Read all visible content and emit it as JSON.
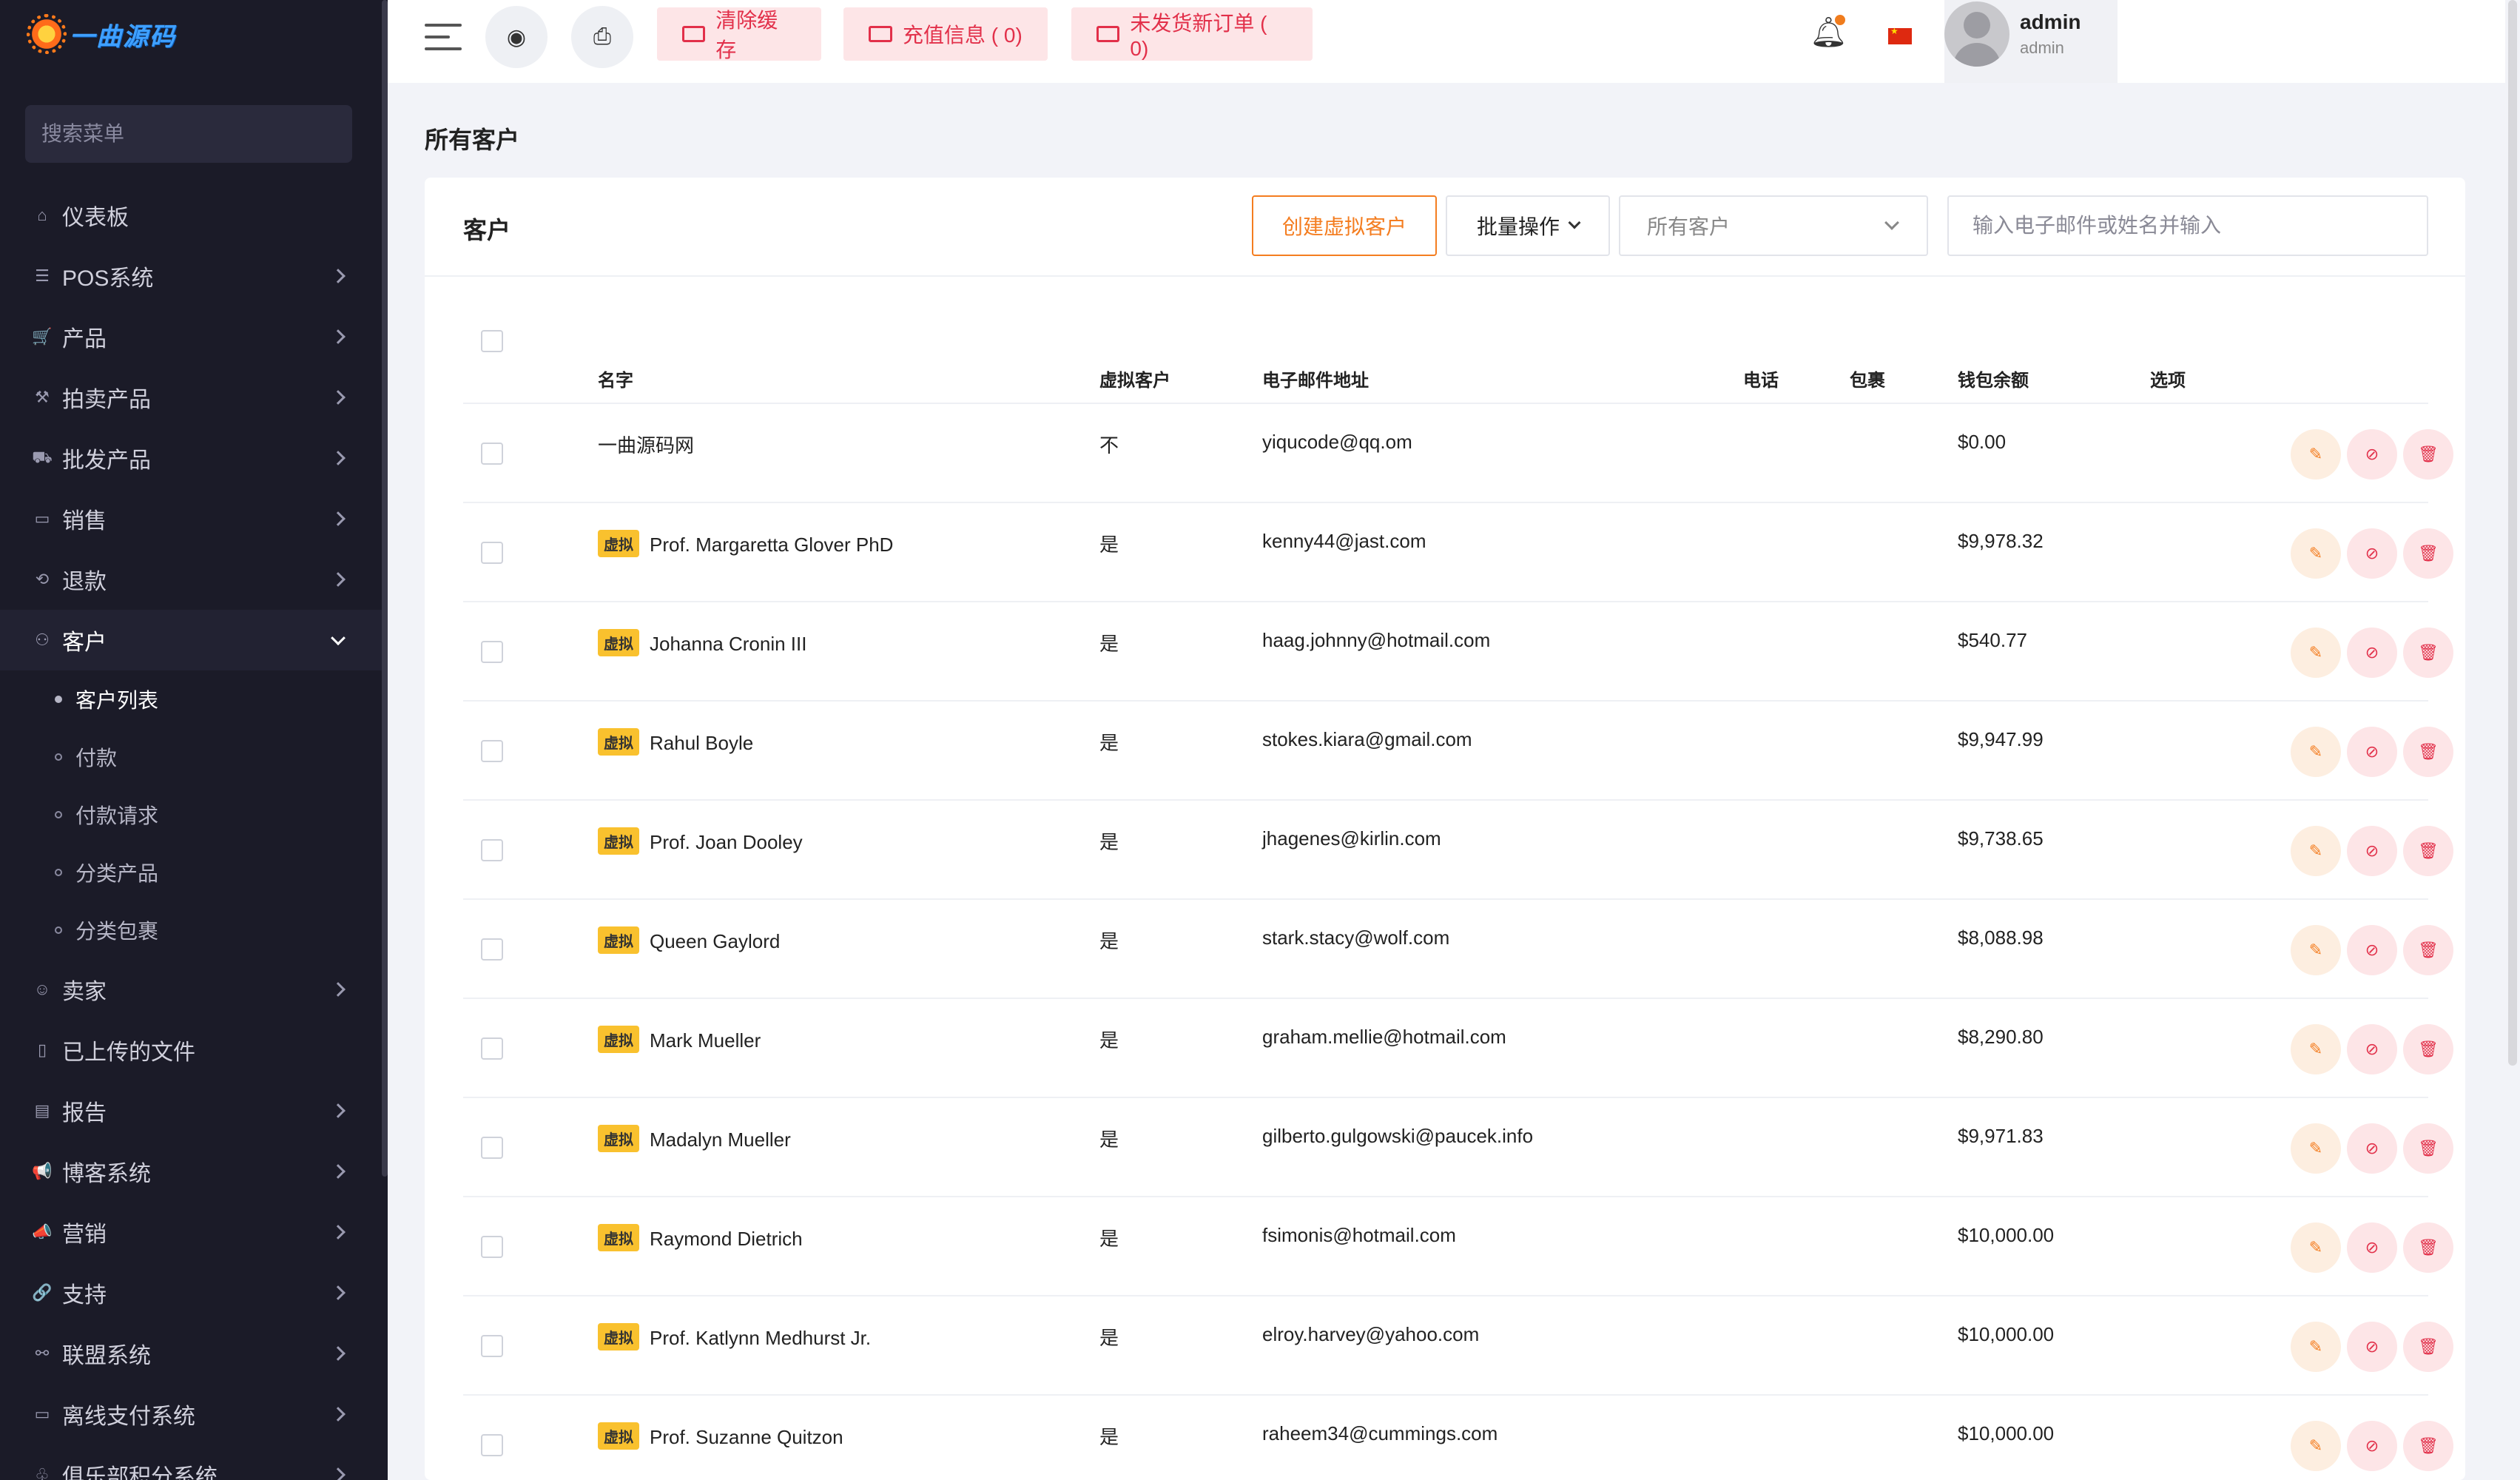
{
  "brand": {
    "logo_text": "一曲源码"
  },
  "sidebar": {
    "search_placeholder": "搜索菜单",
    "items": [
      {
        "label": "仪表板",
        "icon": "home-icon",
        "glyph": "⌂",
        "has_children": false
      },
      {
        "label": "POS系统",
        "icon": "list-icon",
        "glyph": "☰",
        "has_children": true
      },
      {
        "label": "产品",
        "icon": "cart-icon",
        "glyph": "🛒",
        "has_children": true
      },
      {
        "label": "拍卖产品",
        "icon": "gavel-icon",
        "glyph": "⚒",
        "has_children": true
      },
      {
        "label": "批发产品",
        "icon": "truck-icon",
        "glyph": "⛟",
        "has_children": true
      },
      {
        "label": "销售",
        "icon": "money-icon",
        "glyph": "▭",
        "has_children": true
      },
      {
        "label": "退款",
        "icon": "refund-icon",
        "glyph": "⟲",
        "has_children": true
      },
      {
        "label": "客户",
        "icon": "users-icon",
        "glyph": "⚇",
        "has_children": true,
        "open": true
      }
    ],
    "customer_sub": [
      {
        "label": "客户列表",
        "active": true
      },
      {
        "label": "付款",
        "active": false
      },
      {
        "label": "付款请求",
        "active": false
      },
      {
        "label": "分类产品",
        "active": false
      },
      {
        "label": "分类包裹",
        "active": false
      }
    ],
    "items_after": [
      {
        "label": "卖家",
        "icon": "user-icon",
        "glyph": "☺",
        "has_children": true
      },
      {
        "label": "已上传的文件",
        "icon": "file-icon",
        "glyph": "▯",
        "has_children": false
      },
      {
        "label": "报告",
        "icon": "report-icon",
        "glyph": "▤",
        "has_children": true
      },
      {
        "label": "博客系统",
        "icon": "megaphone-icon",
        "glyph": "📢",
        "has_children": true
      },
      {
        "label": "营销",
        "icon": "bullhorn-icon",
        "glyph": "📣",
        "has_children": true
      },
      {
        "label": "支持",
        "icon": "link-icon",
        "glyph": "🔗",
        "has_children": true
      },
      {
        "label": "联盟系统",
        "icon": "affiliate-icon",
        "glyph": "⚯",
        "has_children": true
      },
      {
        "label": "离线支付系统",
        "icon": "card-icon",
        "glyph": "▭",
        "has_children": true
      },
      {
        "label": "俱乐部积分系统",
        "icon": "club-icon",
        "glyph": "♧",
        "has_children": true
      }
    ]
  },
  "topbar": {
    "clear_cache": "清除缓存",
    "recharge": "充值信息 ( 0)",
    "unshipped": "未发货新订单 ( 0)",
    "user_name": "admin",
    "user_role": "admin"
  },
  "page": {
    "title": "所有客户",
    "card_title": "客户",
    "create_button": "创建虚拟客户",
    "bulk_button": "批量操作",
    "filter_selected": "所有客户",
    "search_placeholder": "输入电子邮件或姓名并输入"
  },
  "table": {
    "headers": {
      "name": "名字",
      "virtual": "虚拟客户",
      "email": "电子邮件地址",
      "phone": "电话",
      "package": "包裹",
      "wallet": "钱包余额",
      "options": "选项"
    },
    "virtual_badge": "虚拟",
    "rows": [
      {
        "name": "一曲源码网",
        "virtual": "不",
        "email": "yiqucode@qq.om",
        "phone": "",
        "package": "",
        "wallet": "$0.00",
        "is_virtual": false
      },
      {
        "name": "Prof. Margaretta Glover PhD",
        "virtual": "是",
        "email": "kenny44@jast.com",
        "phone": "",
        "package": "",
        "wallet": "$9,978.32",
        "is_virtual": true
      },
      {
        "name": "Johanna Cronin III",
        "virtual": "是",
        "email": "haag.johnny@hotmail.com",
        "phone": "",
        "package": "",
        "wallet": "$540.77",
        "is_virtual": true
      },
      {
        "name": "Rahul Boyle",
        "virtual": "是",
        "email": "stokes.kiara@gmail.com",
        "phone": "",
        "package": "",
        "wallet": "$9,947.99",
        "is_virtual": true
      },
      {
        "name": "Prof. Joan Dooley",
        "virtual": "是",
        "email": "jhagenes@kirlin.com",
        "phone": "",
        "package": "",
        "wallet": "$9,738.65",
        "is_virtual": true
      },
      {
        "name": "Queen Gaylord",
        "virtual": "是",
        "email": "stark.stacy@wolf.com",
        "phone": "",
        "package": "",
        "wallet": "$8,088.98",
        "is_virtual": true
      },
      {
        "name": "Mark Mueller",
        "virtual": "是",
        "email": "graham.mellie@hotmail.com",
        "phone": "",
        "package": "",
        "wallet": "$8,290.80",
        "is_virtual": true
      },
      {
        "name": "Madalyn Mueller",
        "virtual": "是",
        "email": "gilberto.gulgowski@paucek.info",
        "phone": "",
        "package": "",
        "wallet": "$9,971.83",
        "is_virtual": true
      },
      {
        "name": "Raymond Dietrich",
        "virtual": "是",
        "email": "fsimonis@hotmail.com",
        "phone": "",
        "package": "",
        "wallet": "$10,000.00",
        "is_virtual": true
      },
      {
        "name": "Prof. Katlynn Medhurst Jr.",
        "virtual": "是",
        "email": "elroy.harvey@yahoo.com",
        "phone": "",
        "package": "",
        "wallet": "$10,000.00",
        "is_virtual": true
      },
      {
        "name": "Prof. Suzanne Quitzon",
        "virtual": "是",
        "email": "raheem34@cummings.com",
        "phone": "",
        "package": "",
        "wallet": "$10,000.00",
        "is_virtual": true
      }
    ]
  },
  "colors": {
    "sidebar_bg": "#1b1b28",
    "accent_orange": "#f47d20",
    "accent_red": "#e2304a",
    "badge_yellow": "#f9c12e"
  }
}
